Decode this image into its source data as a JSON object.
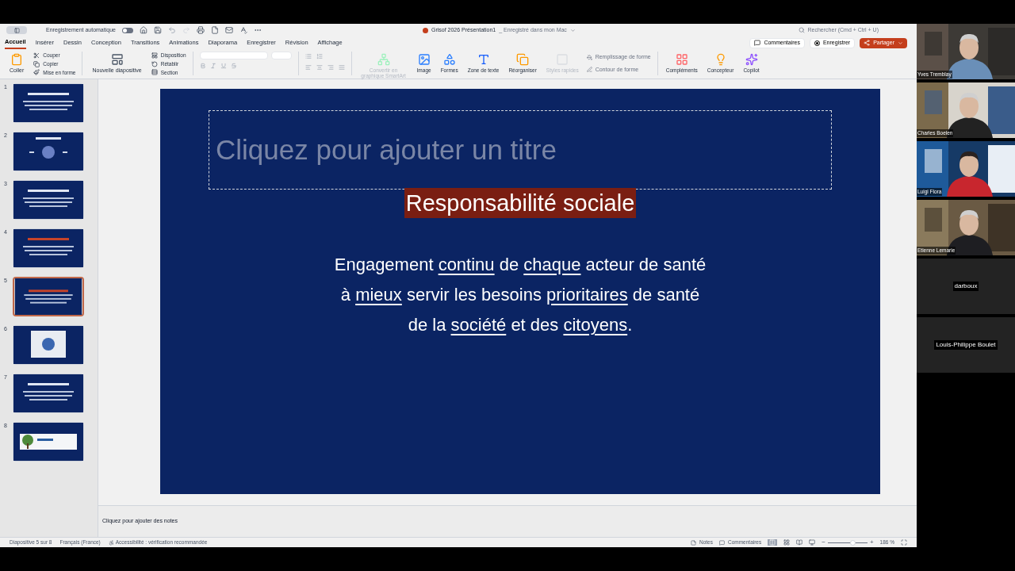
{
  "title_bar": {
    "autosave_label": "Enregistrement automatique",
    "autosave_on": false,
    "document_title": "Grisof 2026 Présentation1",
    "save_status": "_ Enregistré dans mon Mac",
    "search_placeholder": "Rechercher (Cmd + Ctrl + U)"
  },
  "tabs": [
    {
      "label": "Accueil",
      "selected": true
    },
    {
      "label": "Insérer",
      "selected": false
    },
    {
      "label": "Dessin",
      "selected": false
    },
    {
      "label": "Conception",
      "selected": false
    },
    {
      "label": "Transitions",
      "selected": false
    },
    {
      "label": "Animations",
      "selected": false
    },
    {
      "label": "Diaporama",
      "selected": false
    },
    {
      "label": "Enregistrer",
      "selected": false
    },
    {
      "label": "Révision",
      "selected": false
    },
    {
      "label": "Affichage",
      "selected": false
    }
  ],
  "top_actions": {
    "comments": "Commentaires",
    "record": "Enregistrer",
    "share": "Partager"
  },
  "clipboard": {
    "paste": "Coller",
    "items": [
      "Couper",
      "Copier",
      "Mise en forme"
    ]
  },
  "slides_group": {
    "new_slide": "Nouvelle diapositive",
    "items": [
      "Disposition",
      "Rétablir",
      "Section"
    ]
  },
  "ribbon_buttons": [
    {
      "label": "Convertir en graphique SmartArt",
      "disabled": true
    },
    {
      "label": "Image",
      "disabled": false
    },
    {
      "label": "Formes",
      "disabled": false
    },
    {
      "label": "Zone de texte",
      "disabled": false
    },
    {
      "label": "Réorganiser",
      "disabled": false
    },
    {
      "label": "Styles rapides",
      "disabled": true
    }
  ],
  "shape_format": [
    {
      "label": "Remplissage de forme",
      "disabled": true
    },
    {
      "label": "Contour de forme",
      "disabled": true
    }
  ],
  "extra_buttons": [
    {
      "label": "Compléments",
      "disabled": false
    },
    {
      "label": "Concepteur",
      "disabled": false
    },
    {
      "label": "Copilot",
      "disabled": false
    }
  ],
  "thumbnails": [
    {
      "number": "1",
      "selected": false
    },
    {
      "number": "2",
      "selected": false
    },
    {
      "number": "3",
      "selected": false
    },
    {
      "number": "4",
      "selected": false
    },
    {
      "number": "5",
      "selected": true
    },
    {
      "number": "6",
      "selected": false
    },
    {
      "number": "7",
      "selected": false
    },
    {
      "number": "8",
      "selected": false
    }
  ],
  "slide": {
    "title_placeholder": "Cliquez pour ajouter un titre",
    "heading": "Responsabilité sociale",
    "body_lines": [
      [
        {
          "text": "Engagement ",
          "underlined": false
        },
        {
          "text": "continu",
          "underlined": true
        },
        {
          "text": " de ",
          "underlined": false
        },
        {
          "text": "chaque",
          "underlined": true
        },
        {
          "text": " acteur de santé",
          "underlined": false
        }
      ],
      [
        {
          "text": "à ",
          "underlined": false
        },
        {
          "text": "mieux",
          "underlined": true
        },
        {
          "text": " servir les besoins ",
          "underlined": false
        },
        {
          "text": "prioritaires",
          "underlined": true
        },
        {
          "text": " de santé",
          "underlined": false
        }
      ],
      [
        {
          "text": "de la ",
          "underlined": false
        },
        {
          "text": "société",
          "underlined": true
        },
        {
          "text": " et des ",
          "underlined": false
        },
        {
          "text": "citoyens",
          "underlined": true
        },
        {
          "text": ".",
          "underlined": false
        }
      ]
    ]
  },
  "notes_placeholder": "Cliquez pour ajouter des notes",
  "status_bar": {
    "slide_info": "Diapositive 5 sur 8",
    "language": "Français (France)",
    "accessibility": "Accessibilité : vérification recommandée",
    "notes": "Notes",
    "comments": "Commentaires",
    "zoom": {
      "level": 0.62
    },
    "zoom_out": "−",
    "zoom_in": "+",
    "zoom_reading": "186 %"
  },
  "participants": [
    {
      "name": "Yves Tremblay",
      "kind": "video"
    },
    {
      "name": "Charles Boelen",
      "kind": "video"
    },
    {
      "name": "Luigi Flora",
      "kind": "video"
    },
    {
      "name": "Etienne Lemarie",
      "kind": "video"
    },
    {
      "name": "darboux",
      "kind": "name_only"
    },
    {
      "name": "Louis-Philippe Boulet",
      "kind": "name_only"
    }
  ]
}
